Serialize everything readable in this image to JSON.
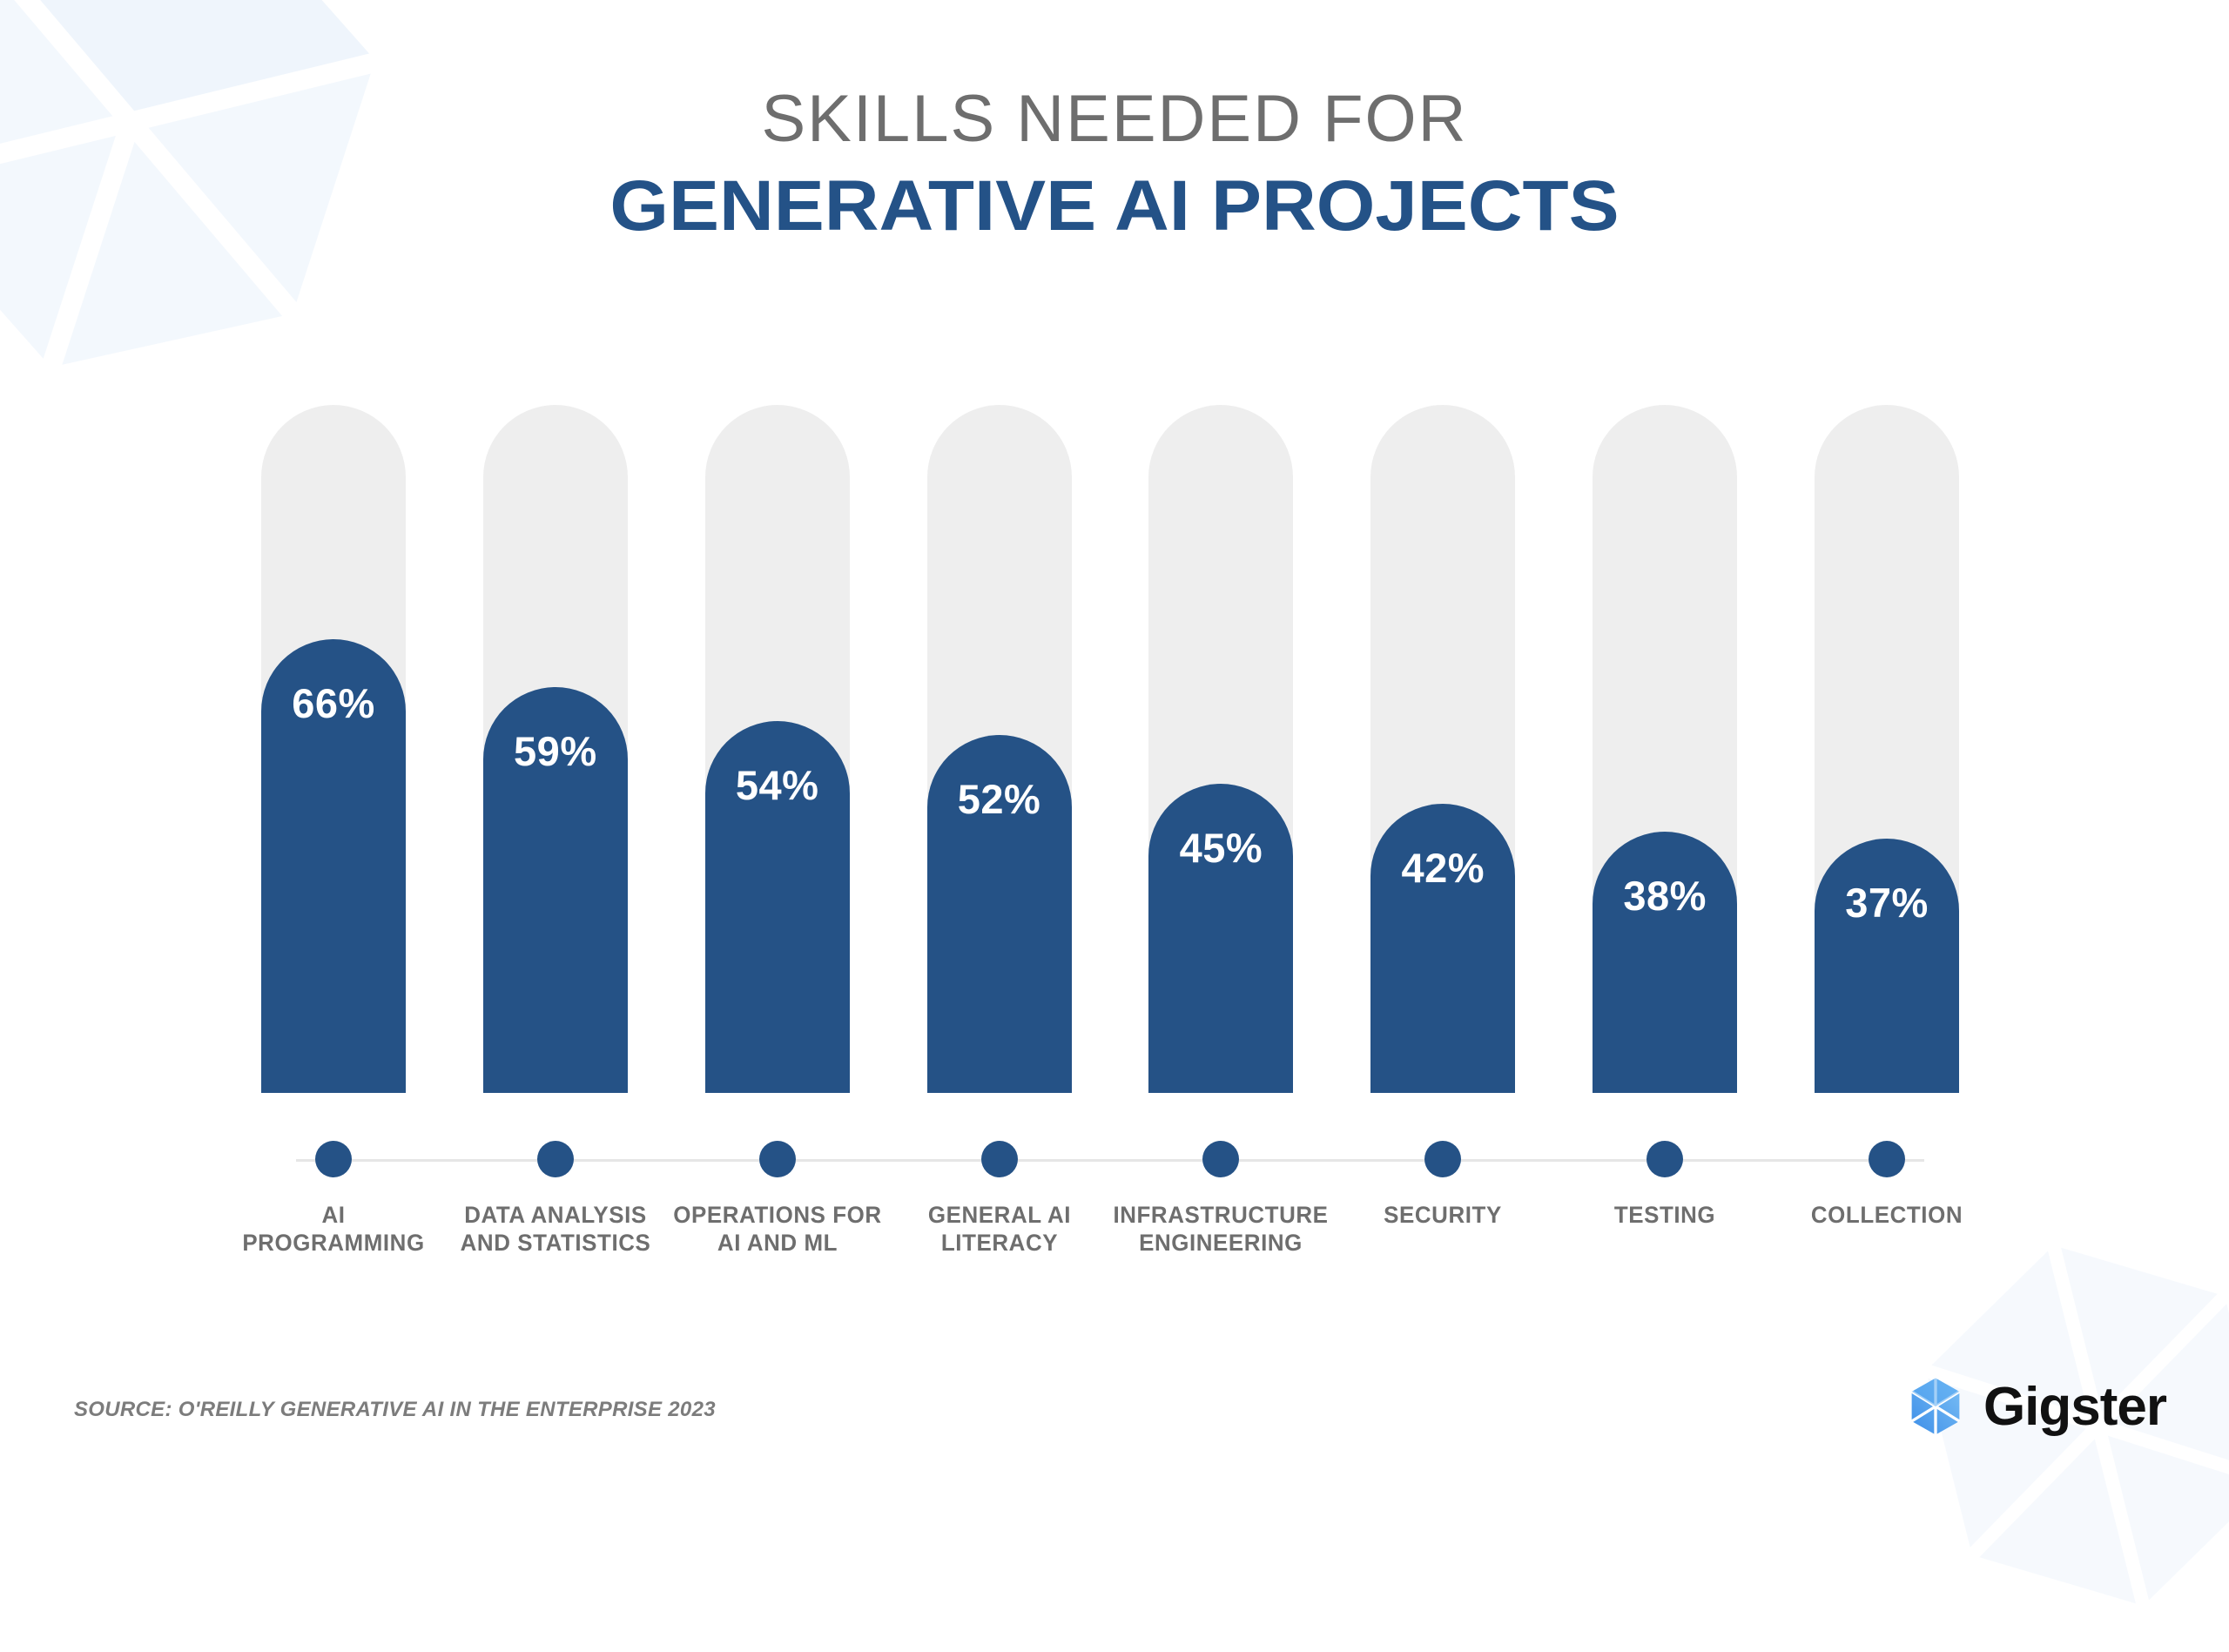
{
  "header": {
    "title_line1": "SKILLS NEEDED FOR",
    "title_line2": "GENERATIVE AI PROJECTS"
  },
  "footer": {
    "source_label": "SOURCE:",
    "source_text": "O'REILLY GENERATIVE AI IN THE ENTERPRISE 2023",
    "brand_name": "Gigster",
    "brand_icon": "gigster-gem-icon"
  },
  "colors": {
    "bar_fill": "#255286",
    "track": "#eeeeee",
    "title_top": "#6e6e6e",
    "title_main": "#245287",
    "label": "#6e6e6e",
    "axis_line": "#e6e6e6",
    "background": "#ffffff",
    "watermark": "#eaf3fc"
  },
  "chart_data": {
    "type": "bar",
    "title": "SKILLS NEEDED FOR GENERATIVE AI PROJECTS",
    "subtitle": "",
    "xlabel": "",
    "ylabel": "",
    "ylim": [
      0,
      100
    ],
    "grid": false,
    "legend": "none",
    "orientation": "vertical",
    "value_suffix": "%",
    "source": "SOURCE: O'REILLY GENERATIVE AI IN THE ENTERPRISE 2023",
    "categories": [
      "AI PROGRAMMING",
      "DATA ANALYSIS AND STATISTICS",
      "OPERATIONS FOR AI AND ML",
      "GENERAL AI LITERACY",
      "INFRASTRUCTURE ENGINEERING",
      "SECURITY",
      "TESTING",
      "COLLECTION"
    ],
    "values": [
      66,
      59,
      54,
      52,
      45,
      42,
      38,
      37
    ],
    "labels": [
      "66%",
      "59%",
      "54%",
      "52%",
      "45%",
      "42%",
      "38%",
      "37%"
    ],
    "bars": [
      {
        "label_line1": "AI",
        "label_line2": "PROGRAMMING",
        "value": 66,
        "display": "66%"
      },
      {
        "label_line1": "DATA ANALYSIS",
        "label_line2": "AND STATISTICS",
        "value": 59,
        "display": "59%"
      },
      {
        "label_line1": "OPERATIONS FOR",
        "label_line2": "AI AND ML",
        "value": 54,
        "display": "54%"
      },
      {
        "label_line1": "GENERAL AI",
        "label_line2": "LITERACY",
        "value": 52,
        "display": "52%"
      },
      {
        "label_line1": "INFRASTRUCTURE",
        "label_line2": "ENGINEERING",
        "value": 45,
        "display": "45%"
      },
      {
        "label_line1": "SECURITY",
        "label_line2": "",
        "value": 42,
        "display": "42%"
      },
      {
        "label_line1": "TESTING",
        "label_line2": "",
        "value": 38,
        "display": "38%"
      },
      {
        "label_line1": "COLLECTION",
        "label_line2": "",
        "value": 37,
        "display": "37%"
      }
    ]
  }
}
